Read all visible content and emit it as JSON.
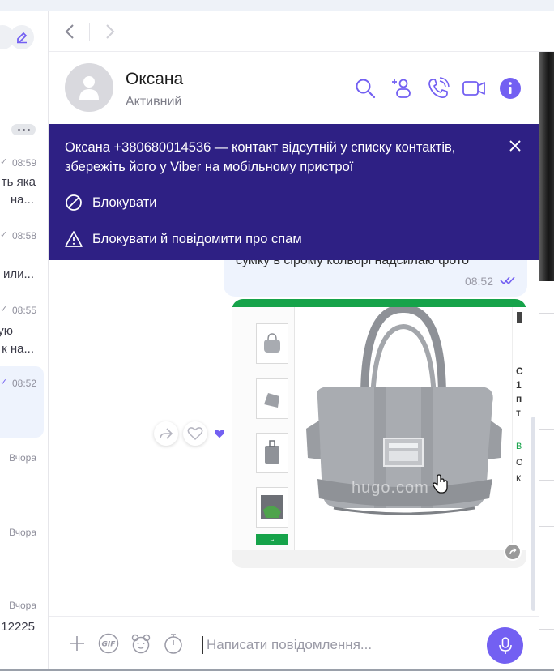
{
  "colors": {
    "accent": "#7360f2",
    "banner_bg": "#2e2084",
    "bubble_bg": "#eef3fd",
    "image_green": "#16a34a"
  },
  "left_list": {
    "more_icon": "more-dots-icon",
    "items": [
      {
        "time": "08:59",
        "lines": [
          "ть яка",
          "на..."
        ]
      },
      {
        "time": "08:58",
        "lines": [
          "или..."
        ]
      },
      {
        "time": "08:55",
        "lines": [
          "ую",
          "к на..."
        ]
      },
      {
        "time": "08:52",
        "lines": []
      },
      {
        "time": "Вчора",
        "lines": []
      },
      {
        "time": "Вчора",
        "lines": []
      },
      {
        "time": "Вчора",
        "lines": [
          "12225"
        ]
      }
    ]
  },
  "header": {
    "contact_name": "Оксана",
    "contact_status": "Активний",
    "icons": [
      "search-icon",
      "add-participant-icon",
      "voice-call-icon",
      "video-call-icon",
      "info-icon"
    ]
  },
  "banner": {
    "text": "Оксана +380680014536 — контакт відсутній у списку контактів, збережіть його у Viber на мобільному пристрої",
    "block_label": "Блокувати",
    "block_spam_label": "Блокувати й повідомити про спам"
  },
  "messages": {
    "text_message": {
      "text": "сумку в сірому кольорі надсилаю фото",
      "time": "08:52",
      "status": "read"
    },
    "image_message": {
      "watermark": "hugo.com",
      "side_letters": [
        "С",
        "1",
        "п",
        "т"
      ],
      "side_lower": [
        "В",
        "О",
        "К"
      ],
      "reaction_icon": "heart-icon",
      "reaction_count_shown": "purple-heart"
    }
  },
  "composer": {
    "placeholder": "Написати повідомлення...",
    "icons": [
      "plus-icon",
      "gif-icon",
      "sticker-icon",
      "timer-icon",
      "microphone-icon"
    ]
  }
}
